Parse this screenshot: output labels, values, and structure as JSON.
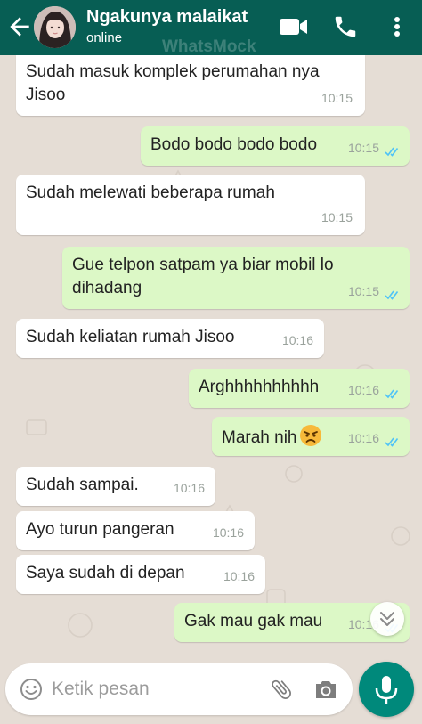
{
  "header": {
    "contact_name": "Ngakunya malaikat",
    "status": "online",
    "watermark": "WhatsMock"
  },
  "messages": [
    {
      "direction": "in",
      "lines": [
        "Sudah masuk komplek perumahan nya",
        "Jisoo"
      ],
      "time": "10:15"
    },
    {
      "direction": "out",
      "text": "Bodo bodo bodo bodo",
      "time": "10:15",
      "ticks": "read"
    },
    {
      "direction": "in",
      "text": "Sudah melewati beberapa rumah",
      "time": "10:15"
    },
    {
      "direction": "out",
      "lines": [
        "Gue telpon satpam ya biar mobil lo",
        "dihadang"
      ],
      "time": "10:15",
      "ticks": "read"
    },
    {
      "direction": "in",
      "text": "Sudah keliatan rumah Jisoo",
      "time": "10:16"
    },
    {
      "direction": "out",
      "text": "Arghhhhhhhhhh",
      "time": "10:16",
      "ticks": "read"
    },
    {
      "direction": "out",
      "text": "Marah nih",
      "emoji": "angry-face-emoji",
      "time": "10:16",
      "ticks": "read"
    },
    {
      "direction": "in",
      "text": "Sudah sampai.",
      "time": "10:16"
    },
    {
      "direction": "in",
      "text": "Ayo turun pangeran",
      "time": "10:16"
    },
    {
      "direction": "in",
      "text": "Saya sudah di depan",
      "time": "10:16"
    },
    {
      "direction": "out",
      "text": "Gak mau gak mau",
      "time": "10:16",
      "ticks": "read"
    }
  ],
  "composer": {
    "placeholder": "Ketik pesan",
    "value": ""
  },
  "icons": {
    "back": "arrow-left-icon",
    "video_call": "video-camera-icon",
    "voice_call": "phone-icon",
    "menu": "more-vert-icon",
    "emoji": "smiley-icon",
    "attach": "paperclip-icon",
    "camera": "camera-icon",
    "mic": "microphone-icon",
    "scroll_down": "double-chevron-down-icon",
    "read_receipt": "double-check-icon"
  },
  "colors": {
    "header": "#075e54",
    "chat_background": "#e5ddd5",
    "incoming_bubble": "#ffffff",
    "outgoing_bubble": "#dcf8c6",
    "read_tick": "#4fc3f7",
    "mic_button": "#00897b"
  }
}
